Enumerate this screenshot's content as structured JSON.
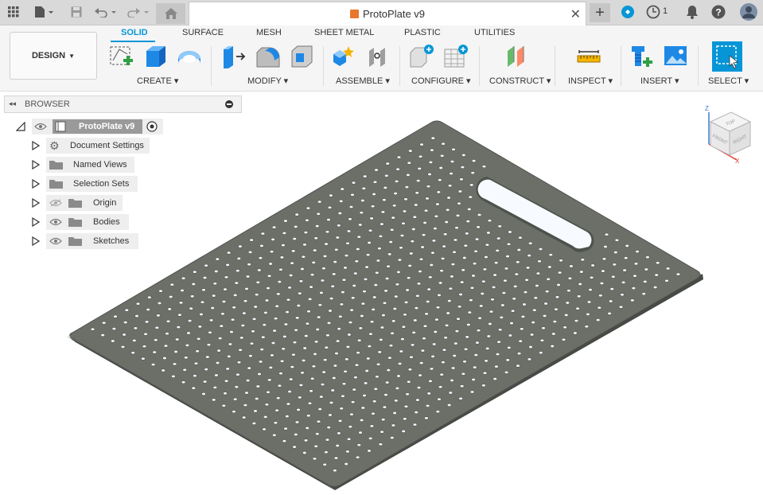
{
  "document": {
    "title": "ProtoPlate v9"
  },
  "header": {
    "job_count": "1"
  },
  "workspace": {
    "label": "DESIGN"
  },
  "tabs": [
    "SOLID",
    "SURFACE",
    "MESH",
    "SHEET METAL",
    "PLASTIC",
    "UTILITIES"
  ],
  "active_tab": "SOLID",
  "groups": [
    "CREATE",
    "MODIFY",
    "ASSEMBLE",
    "CONFIGURE",
    "CONSTRUCT",
    "INSPECT",
    "INSERT",
    "SELECT"
  ],
  "browser": {
    "title": "BROWSER",
    "root": "ProtoPlate v9",
    "items": [
      "Document Settings",
      "Named Views",
      "Selection Sets",
      "Origin",
      "Bodies",
      "Sketches"
    ]
  },
  "viewcube": {
    "faces": [
      "TOP",
      "FRONT",
      "RIGHT"
    ],
    "axes": [
      "Z",
      "X"
    ]
  },
  "colors": {
    "accent": "#0696d7",
    "plate": "#6b6f68",
    "plate_edge": "#4a4d48",
    "doc_icon": "#e8762c"
  },
  "icons": [
    "apps-grid-icon",
    "file-icon",
    "save-icon",
    "undo-icon",
    "redo-icon",
    "home-icon",
    "close-icon",
    "plus-icon",
    "extensions-icon",
    "job-status-icon",
    "notifications-icon",
    "help-icon",
    "user-avatar-icon"
  ]
}
